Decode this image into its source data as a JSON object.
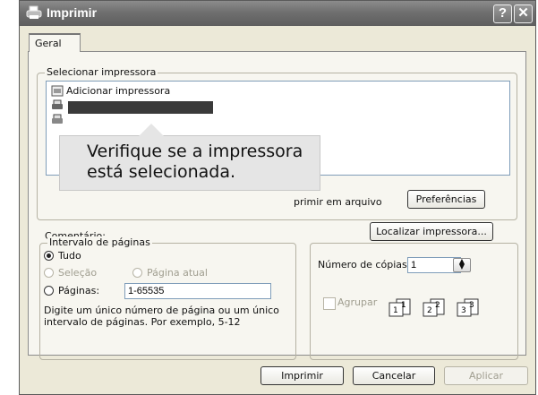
{
  "window": {
    "title": "Imprimir",
    "help_label": "?",
    "close_label": "✕"
  },
  "tabs": [
    {
      "label": "Geral"
    }
  ],
  "select_printer": {
    "legend": "Selecionar impressora",
    "items": [
      {
        "label": "Adicionar impressora"
      }
    ],
    "print_to_file_label": "primir em arquivo",
    "preferences_label": "Preferências",
    "comment_label": "Comentário:",
    "find_printer_label": "Localizar impressora..."
  },
  "callout": {
    "text": "Verifique se a impressora\nestá selecionada."
  },
  "page_range": {
    "legend": "Intervalo de páginas",
    "all_label": "Tudo",
    "selection_label": "Seleção",
    "current_page_label": "Página atual",
    "pages_label": "Páginas:",
    "pages_value": "1-65535",
    "hint": "Digite um único número de página ou um único intervalo de páginas. Por exemplo, 5-12"
  },
  "copies": {
    "label": "Número de cópias:",
    "value": "1",
    "collate_label": "Agrupar"
  },
  "buttons": {
    "print": "Imprimir",
    "cancel": "Cancelar",
    "apply": "Aplicar"
  }
}
